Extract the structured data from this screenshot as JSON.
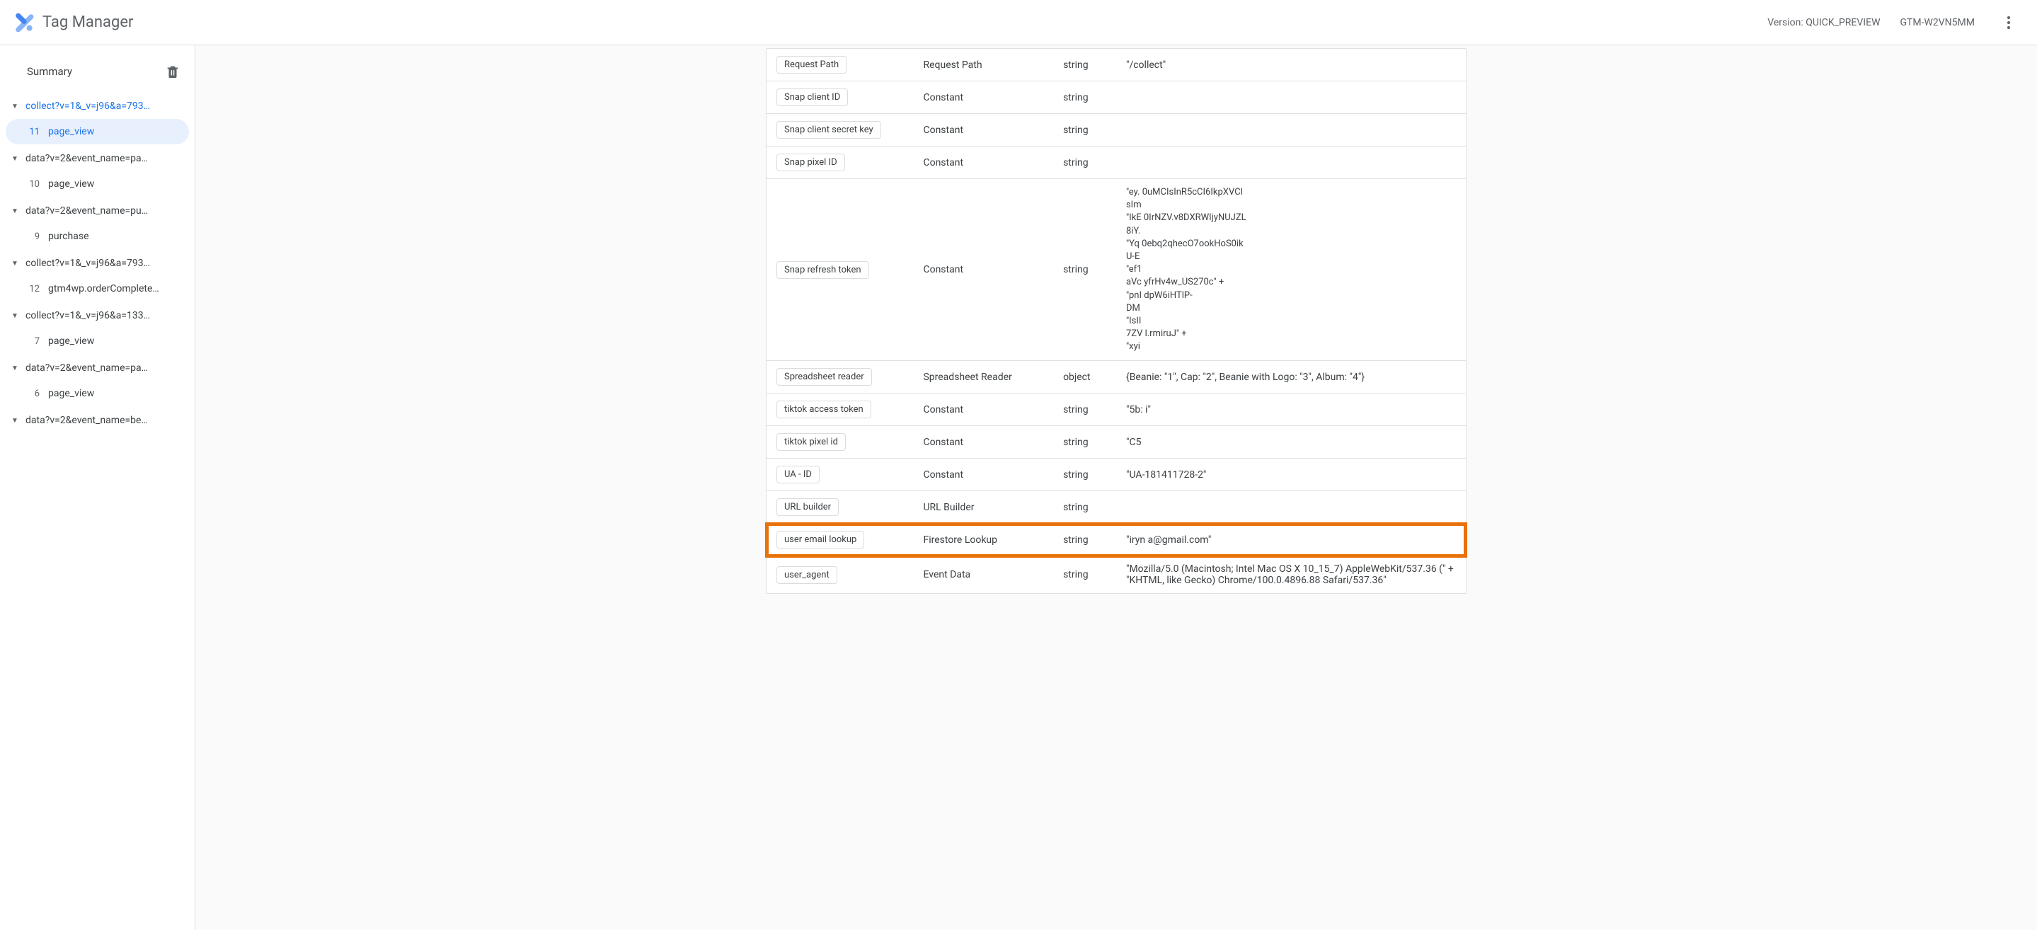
{
  "header": {
    "title": "Tag Manager",
    "version_label": "Version: QUICK_PREVIEW",
    "container_id": "GTM-W2VN5MM"
  },
  "sidebar": {
    "summary_label": "Summary",
    "groups": [
      {
        "label": "collect?v=1&_v=j96&a=793…",
        "active": true,
        "children": [
          {
            "num": "11",
            "label": "page_view",
            "active": true
          }
        ]
      },
      {
        "label": "data?v=2&event_name=pa…",
        "active": false,
        "children": [
          {
            "num": "10",
            "label": "page_view",
            "active": false
          }
        ]
      },
      {
        "label": "data?v=2&event_name=pu…",
        "active": false,
        "children": [
          {
            "num": "9",
            "label": "purchase",
            "active": false
          }
        ]
      },
      {
        "label": "collect?v=1&_v=j96&a=793…",
        "active": false,
        "children": [
          {
            "num": "12",
            "label": "gtm4wp.orderComplete…",
            "active": false
          }
        ]
      },
      {
        "label": "collect?v=1&_v=j96&a=133…",
        "active": false,
        "children": [
          {
            "num": "7",
            "label": "page_view",
            "active": false
          }
        ]
      },
      {
        "label": "data?v=2&event_name=pa…",
        "active": false,
        "children": [
          {
            "num": "6",
            "label": "page_view",
            "active": false
          }
        ]
      },
      {
        "label": "data?v=2&event_name=be…",
        "active": false,
        "children": []
      }
    ]
  },
  "variables": [
    {
      "name": "Request Path",
      "type": "Request Path",
      "rtype": "string",
      "value": "\"/collect\""
    },
    {
      "name": "Snap client ID",
      "type": "Constant",
      "rtype": "string",
      "value": ""
    },
    {
      "name": "Snap client secret key",
      "type": "Constant",
      "rtype": "string",
      "value": ""
    },
    {
      "name": "Snap pixel ID",
      "type": "Constant",
      "rtype": "string",
      "value": ""
    },
    {
      "name": "Snap refresh token",
      "type": "Constant",
      "rtype": "string",
      "value": "\"ey.                                                          0uMCIsInR5cCI6IkpXVCI\nsIm                                                          \n\"IkE                                                           0IrNZV.v8DXRWIjyNUJZL\n8iY.                                                           \n\"Yq                                                            0ebq2qhecO7ookHoS0ik\nU-E                                                           \n\"ef1                                                           \naVc                                                            yfrHv4w_US270c\" +\n\"pnI                                                           dpW6iHTlP-\nDM                                                            \n\"IsII                                                           \n7ZV                                                            l.rmiruJ\" +\n\"xyi"
    },
    {
      "name": "Spreadsheet reader",
      "type": "Spreadsheet Reader",
      "rtype": "object",
      "value": "{Beanie: \"1\", Cap: \"2\", Beanie with Logo: \"3\", Album: \"4\"}"
    },
    {
      "name": "tiktok access token",
      "type": "Constant",
      "rtype": "string",
      "value": "\"5b:                                                            i\""
    },
    {
      "name": "tiktok pixel id",
      "type": "Constant",
      "rtype": "string",
      "value": "\"C5"
    },
    {
      "name": "UA - ID",
      "type": "Constant",
      "rtype": "string",
      "value": "\"UA-181411728-2\""
    },
    {
      "name": "URL builder",
      "type": "URL Builder",
      "rtype": "string",
      "value": ""
    },
    {
      "name": "user email lookup",
      "type": "Firestore Lookup",
      "rtype": "string",
      "value": "\"iryn                  a@gmail.com\"",
      "highlight": true
    },
    {
      "name": "user_agent",
      "type": "Event Data",
      "rtype": "string",
      "value": "\"Mozilla/5.0 (Macintosh; Intel Mac OS X 10_15_7) AppleWebKit/537.36 (\" + \"KHTML, like Gecko) Chrome/100.0.4896.88 Safari/537.36\""
    }
  ]
}
